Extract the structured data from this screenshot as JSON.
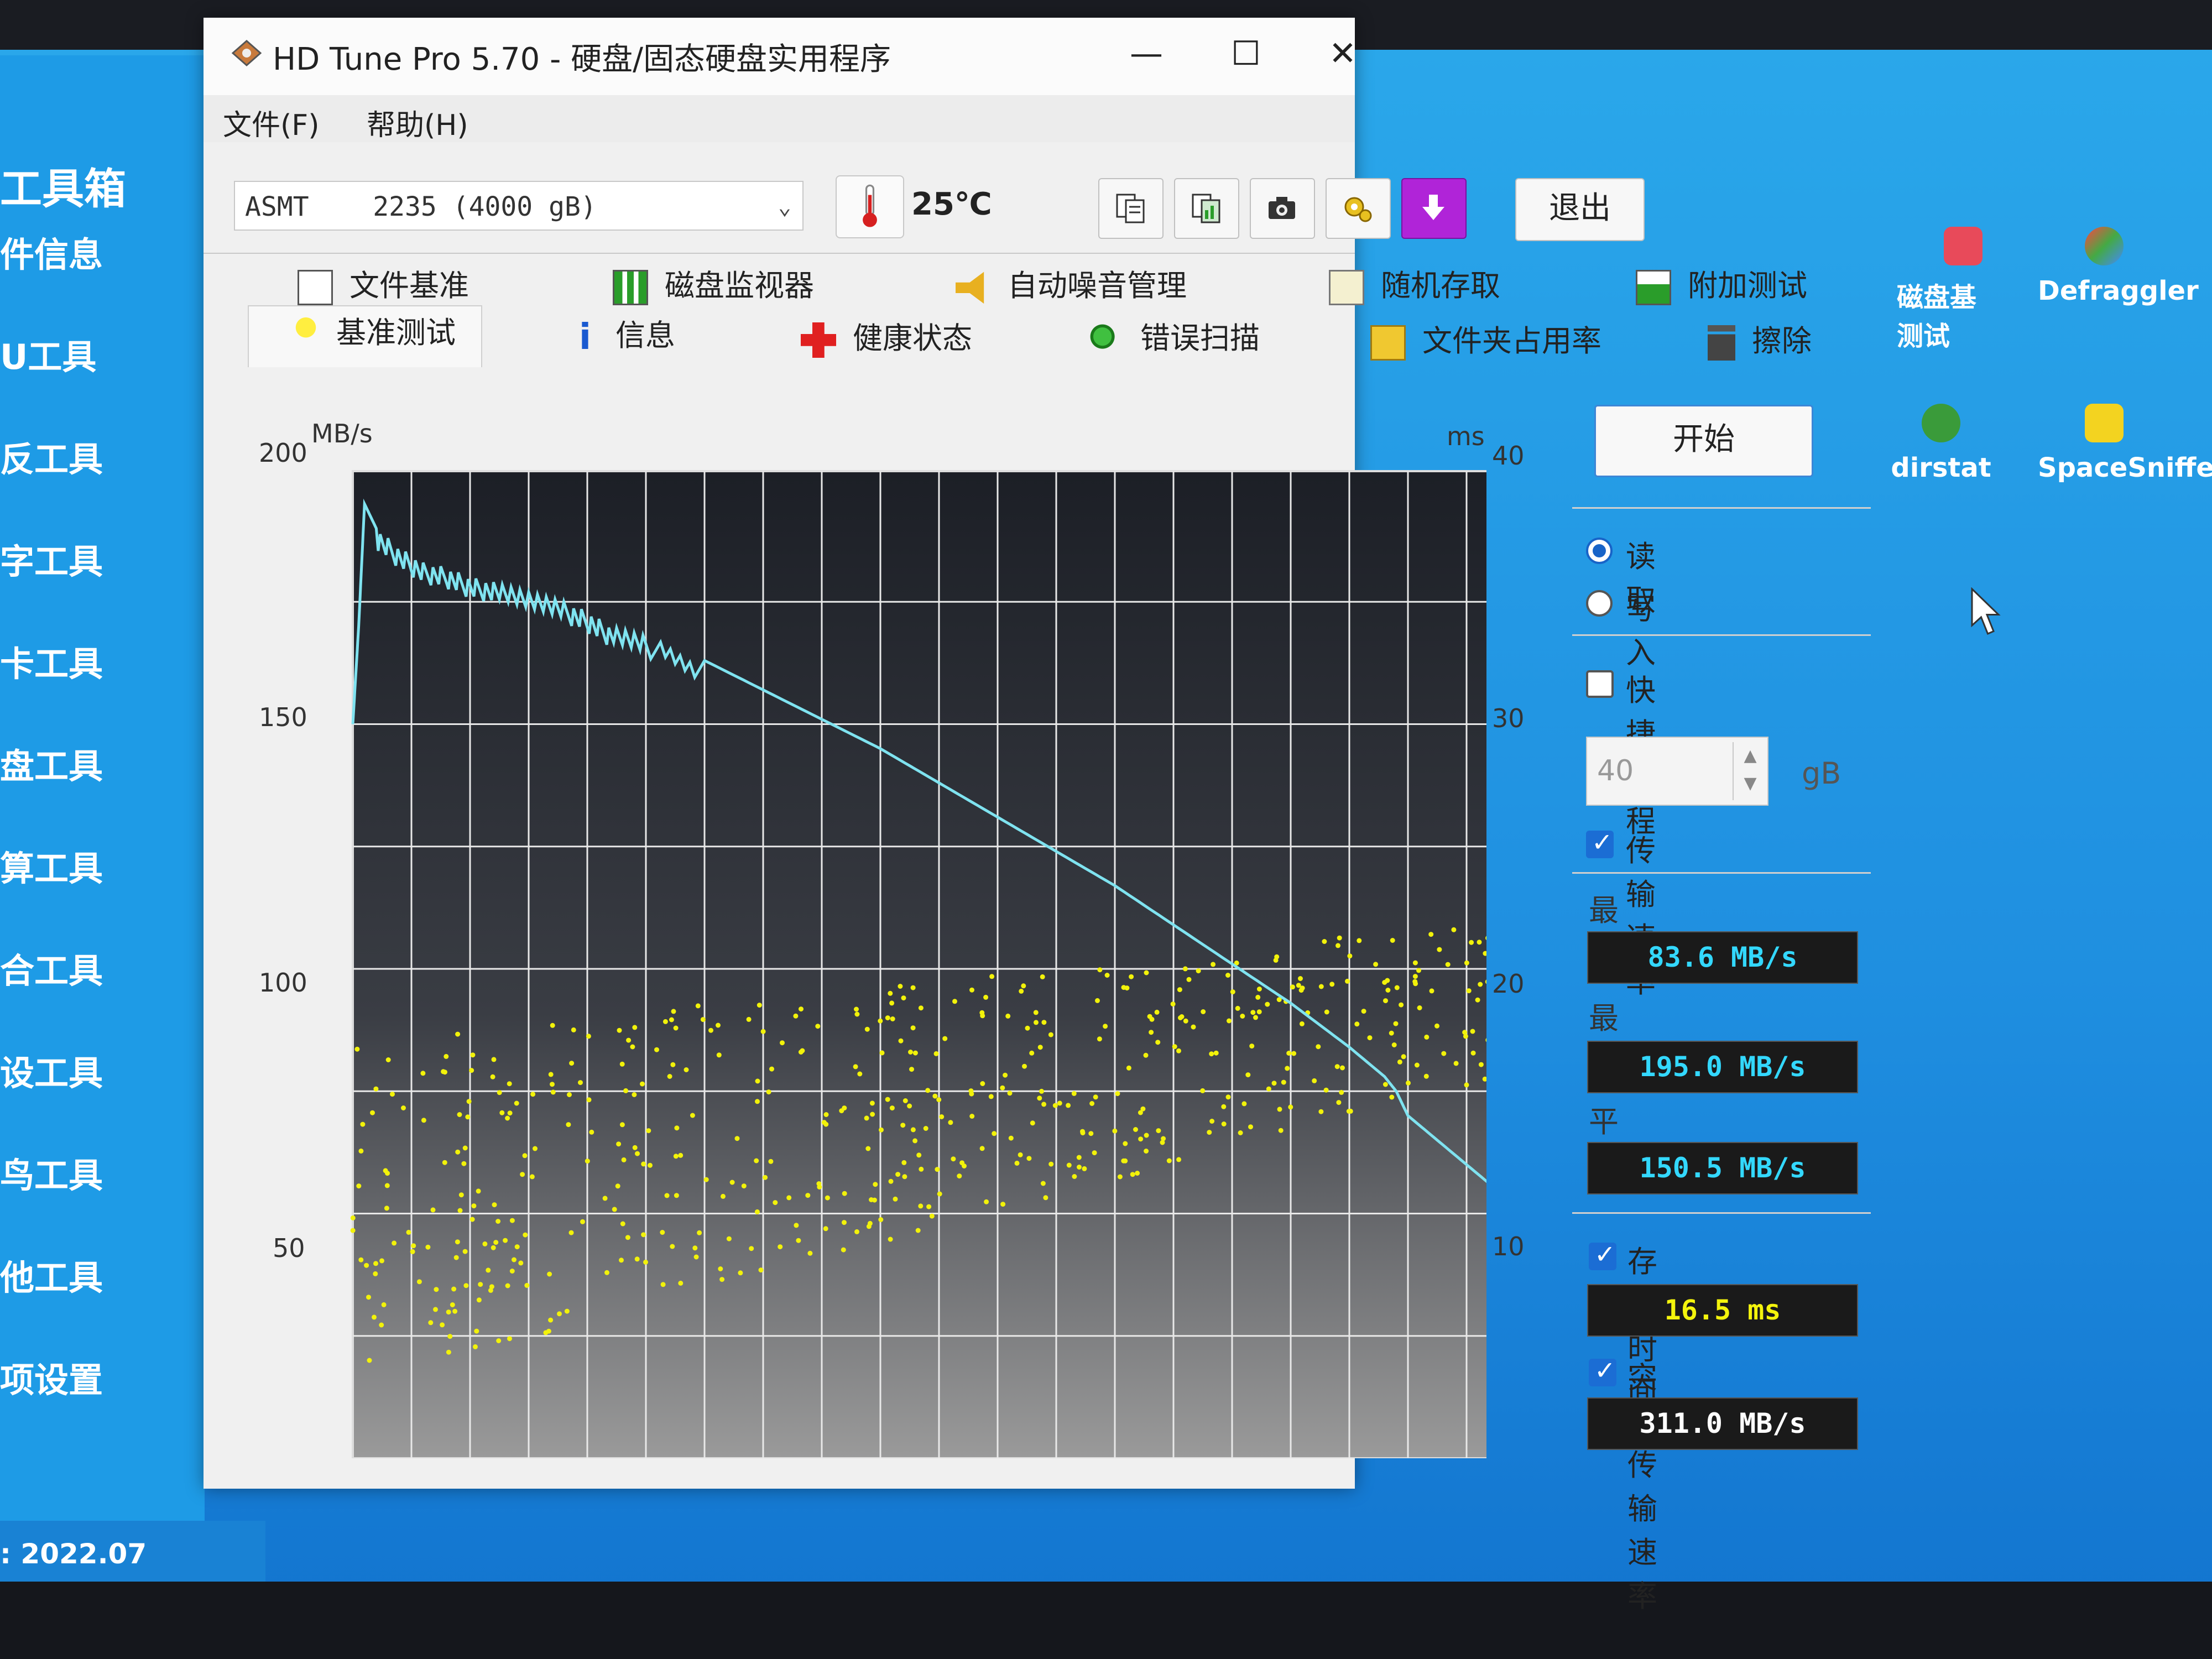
{
  "desktop": {
    "toolbox_title": "工具箱",
    "toolbox_items": [
      "件信息",
      "U工具",
      "反工具",
      "字工具",
      "卡工具",
      "盘工具",
      "算工具",
      "合工具",
      "设工具",
      "鸟工具",
      "他工具",
      "项设置"
    ],
    "toolbox_footer": ": 2022.07",
    "icons": [
      {
        "label": "磁盘基\n测试",
        "icon": "disk-benchmark-icon"
      },
      {
        "label": "Defraggler",
        "icon": "defraggler-icon"
      },
      {
        "label": "dirstat",
        "icon": "windirstat-icon"
      },
      {
        "label": "SpaceSniffer",
        "icon": "spacesniffer-icon"
      }
    ]
  },
  "window": {
    "title": "HD Tune Pro 5.70 - 硬盘/固态硬盘实用程序",
    "minimize": "—",
    "maximize": "☐",
    "close": "✕"
  },
  "menu": {
    "file": "文件(F)",
    "help": "帮助(H)"
  },
  "toolbar": {
    "drive": "ASMT    2235 (4000 gB)",
    "temperature": "25℃",
    "exit": "退出"
  },
  "tabs_row1": [
    "文件基准",
    "磁盘监视器",
    "自动噪音管理",
    "随机存取",
    "附加测试"
  ],
  "tabs_row2": [
    "基准测试",
    "信息",
    "健康状态",
    "错误扫描",
    "文件夹占用率",
    "擦除"
  ],
  "chart_data": {
    "type": "line",
    "ylabel_left": "MB/s",
    "ylabel_right": "ms",
    "ylim_left": [
      0,
      200
    ],
    "ylim_right": [
      0,
      40
    ],
    "left_ticks": [
      "200",
      "150",
      "100",
      "50"
    ],
    "right_ticks": [
      "40",
      "30",
      "20",
      "10"
    ],
    "series": [
      {
        "kind": "transfer_rate",
        "color": "#7fe3f0",
        "x": [
          0,
          0.5,
          1,
          2,
          4,
          6,
          8,
          10,
          12,
          15,
          18,
          20,
          22,
          25,
          30,
          35,
          40,
          45,
          50,
          55,
          60,
          65,
          70,
          75,
          80,
          85,
          88,
          89,
          90,
          92,
          95,
          98,
          100
        ],
        "values": [
          150,
          170,
          195,
          190,
          186,
          183,
          182,
          180,
          179,
          177,
          175,
          173,
          170,
          168,
          163,
          157,
          151,
          145,
          138,
          131,
          124,
          117,
          109,
          101,
          93,
          84,
          78,
          75,
          70,
          66,
          60,
          54,
          49
        ]
      },
      {
        "kind": "access_time_scatter",
        "color": "#f2f20a",
        "note_range_ms": [
          5,
          28
        ]
      }
    ]
  },
  "panel": {
    "start": "开始",
    "read": "读取",
    "write": "写入",
    "short_stroke": "快捷行程",
    "stroke_value": "40",
    "stroke_unit": "gB",
    "transfer_rate": "传输速率",
    "min_label": "最低",
    "min_value": "83.6 MB/s",
    "max_label": "最高",
    "max_value": "195.0 MB/s",
    "avg_label": "平均",
    "avg_value": "150.5 MB/s",
    "access_time": "存取时间",
    "access_value": "16.5 ms",
    "burst_rate": "突发传输速率",
    "burst_value": "311.0 MB/s",
    "colors": {
      "value_cyan": "#33d8ff",
      "value_yellow": "#f4f40c",
      "value_white": "#ffffff"
    }
  }
}
